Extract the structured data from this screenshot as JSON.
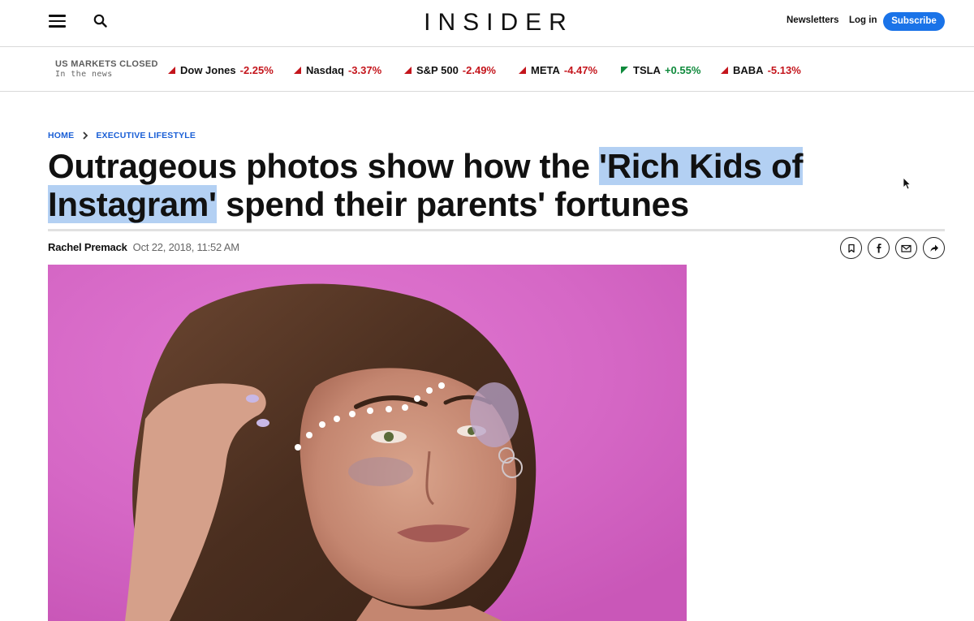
{
  "header": {
    "logo": "INSIDER",
    "newsletters": "Newsletters",
    "login": "Log in",
    "subscribe": "Subscribe",
    "icons": [
      "menu-icon",
      "search-icon"
    ]
  },
  "markets": {
    "status": "US MARKETS CLOSED",
    "sub": "In the news",
    "tickers": [
      {
        "name": "Dow Jones",
        "change": "-2.25%",
        "direction": "down"
      },
      {
        "name": "Nasdaq",
        "change": "-3.37%",
        "direction": "down"
      },
      {
        "name": "S&P 500",
        "change": "-2.49%",
        "direction": "down"
      },
      {
        "name": "META",
        "change": "-4.47%",
        "direction": "down"
      },
      {
        "name": "TSLA",
        "change": "+0.55%",
        "direction": "up"
      },
      {
        "name": "BABA",
        "change": "-5.13%",
        "direction": "down"
      }
    ],
    "colors": {
      "down": "#c4151c",
      "up": "#0f8a3c"
    }
  },
  "breadcrumb": {
    "home": "HOME",
    "category": "EXECUTIVE LIFESTYLE"
  },
  "article": {
    "title_before": "Outrageous photos show how the ",
    "title_highlight": "'Rich Kids of Instagram'",
    "title_after": " spend their parents' fortunes",
    "author": "Rachel Premack",
    "date": "Oct 22, 2018, 11:52 AM",
    "share_icons": [
      "bookmark-icon",
      "facebook-icon",
      "email-icon",
      "share-icon"
    ]
  },
  "colors": {
    "accent": "#1a73e8",
    "link": "#1a5fd6",
    "selection": "#b3d0f3",
    "hero_background": "#d765c6"
  }
}
